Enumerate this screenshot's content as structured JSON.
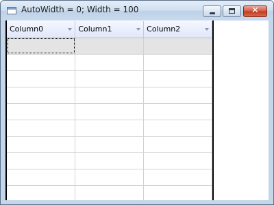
{
  "window": {
    "title": "AutoWidth = 0; Width = 100"
  },
  "grid": {
    "columns": [
      "Column0",
      "Column1",
      "Column2"
    ],
    "row_count": 10,
    "selected_row": 0
  },
  "colors": {
    "selection": "#e4e4e4",
    "header": "#e1e7fa",
    "close_button": "#c0391f"
  }
}
